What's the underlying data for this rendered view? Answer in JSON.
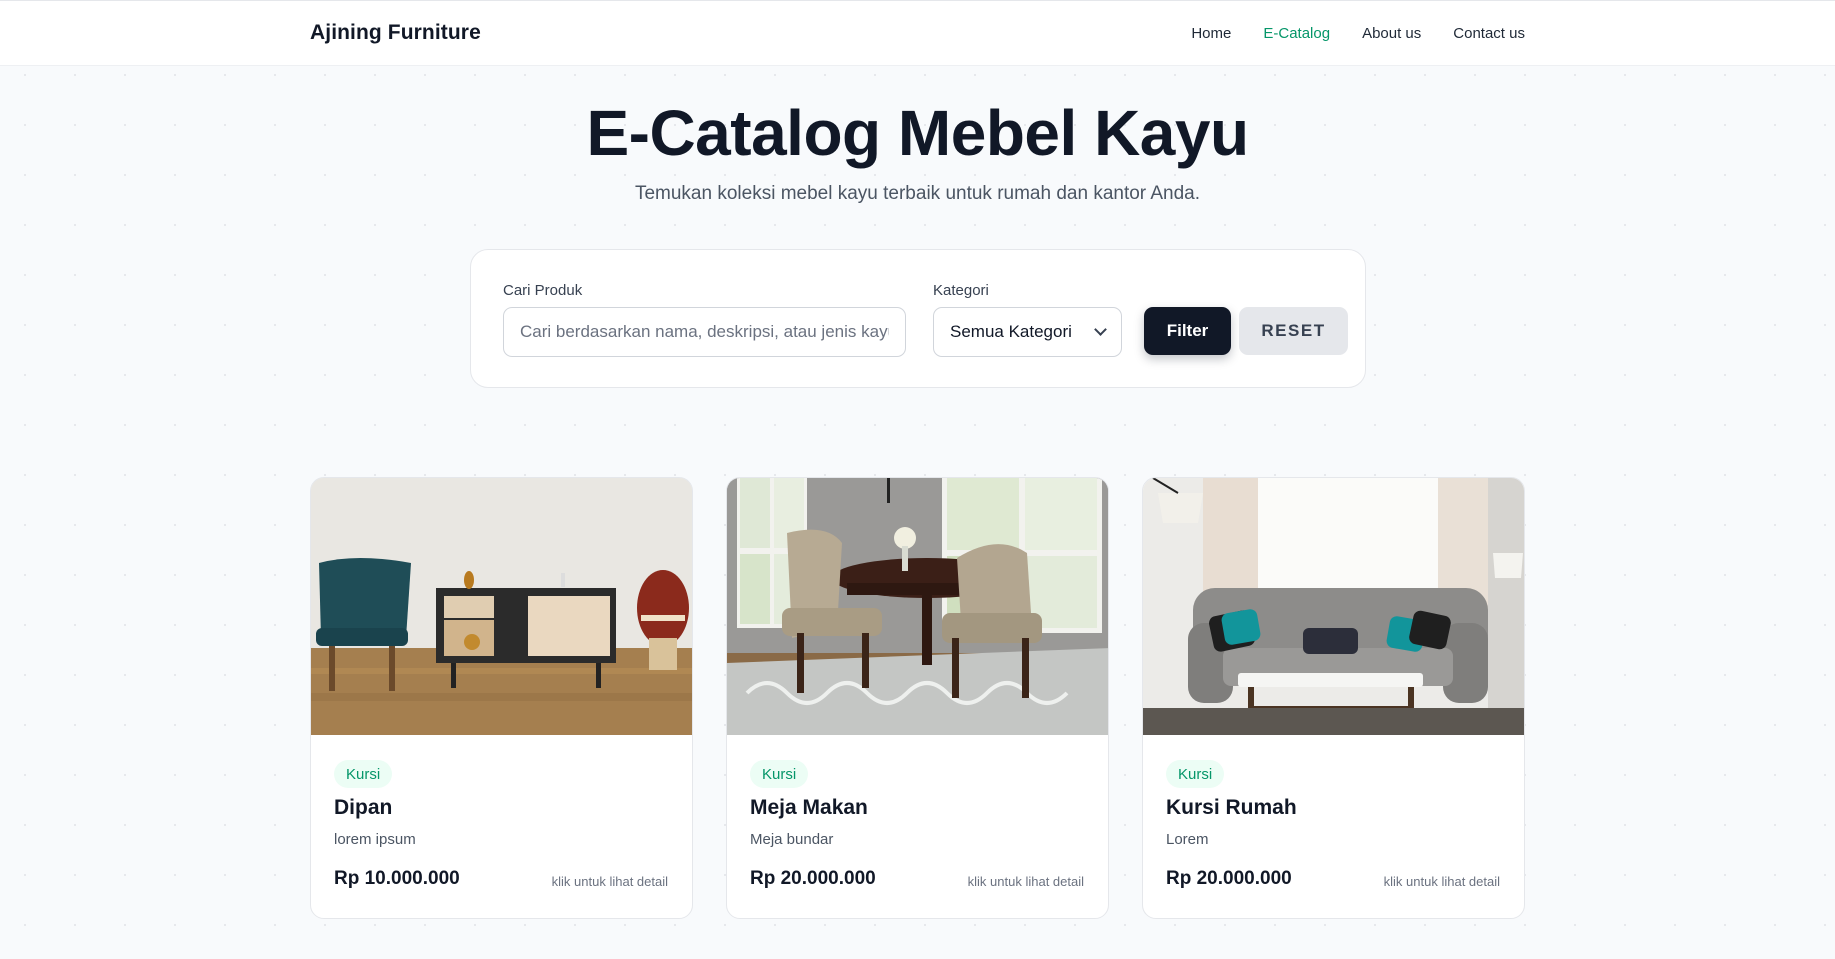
{
  "navbar": {
    "brand": "Ajining Furniture",
    "links": [
      {
        "label": "Home",
        "active": false
      },
      {
        "label": "E-Catalog",
        "active": true
      },
      {
        "label": "About us",
        "active": false
      },
      {
        "label": "Contact us",
        "active": false
      }
    ]
  },
  "hero": {
    "title": "E-Catalog Mebel Kayu",
    "subtitle": "Temukan koleksi mebel kayu terbaik untuk rumah dan kantor Anda."
  },
  "filter": {
    "search_label": "Cari Produk",
    "search_placeholder": "Cari berdasarkan nama, deskripsi, atau jenis kayu",
    "search_value": "",
    "category_label": "Kategori",
    "category_selected": "Semua Kategori",
    "filter_button": "Filter",
    "reset_button": "RESET"
  },
  "products": [
    {
      "category": "Kursi",
      "name": "Dipan",
      "description": "lorem ipsum",
      "price": "Rp 10.000.000",
      "hint": "klik untuk lihat detail",
      "image_icon": "tv-cabinet-photo"
    },
    {
      "category": "Kursi",
      "name": "Meja Makan",
      "description": "Meja bundar",
      "price": "Rp 20.000.000",
      "hint": "klik untuk lihat detail",
      "image_icon": "dining-table-photo"
    },
    {
      "category": "Kursi",
      "name": "Kursi Rumah",
      "description": "Lorem",
      "price": "Rp 20.000.000",
      "hint": "klik untuk lihat detail",
      "image_icon": "sofa-photo"
    }
  ],
  "colors": {
    "accent": "#059669",
    "primary_button": "#111827",
    "badge_bg": "#ecfdf5"
  }
}
